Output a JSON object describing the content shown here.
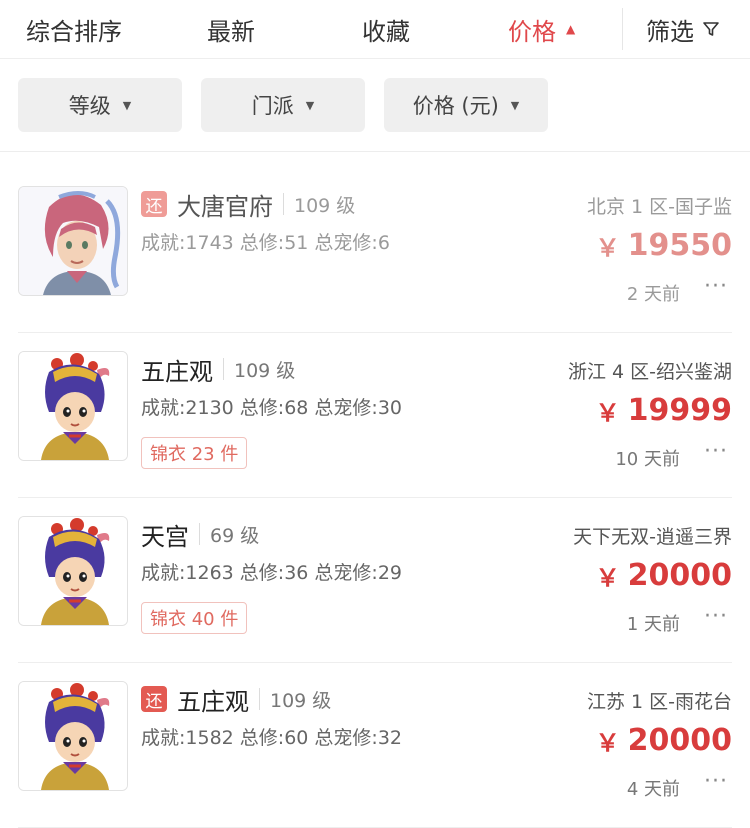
{
  "tabs": [
    {
      "label": "综合排序"
    },
    {
      "label": "最新"
    },
    {
      "label": "收藏"
    },
    {
      "label": "价格",
      "active": true
    },
    {
      "label": "筛选"
    }
  ],
  "filters": [
    {
      "label": "等级"
    },
    {
      "label": "门派"
    },
    {
      "label": "价格 (元)"
    }
  ],
  "items": [
    {
      "badge": "还",
      "sect": "大唐官府",
      "level": "109 级",
      "server": "北京 1 区-国子监",
      "stats": "成就:1743 总修:51 总宠修:6",
      "currency": "￥",
      "price": "19550",
      "time": "2 天前",
      "more": "···"
    },
    {
      "sect": "五庄观",
      "level": "109 级",
      "server": "浙江 4 区-绍兴鉴湖",
      "stats": "成就:2130 总修:68 总宠修:30",
      "tag": "锦衣 23 件",
      "currency": "￥",
      "price": "19999",
      "time": "10 天前",
      "more": "···"
    },
    {
      "sect": "天宫",
      "level": "69 级",
      "server": "天下无双-逍遥三界",
      "stats": "成就:1263 总修:36 总宠修:29",
      "tag": "锦衣 40 件",
      "currency": "￥",
      "price": "20000",
      "time": "1 天前",
      "more": "···"
    },
    {
      "badge": "还",
      "sect": "五庄观",
      "level": "109 级",
      "server": "江苏 1 区-雨花台",
      "stats": "成就:1582 总修:60 总宠修:32",
      "currency": "￥",
      "price": "20000",
      "time": "4 天前",
      "more": "···"
    }
  ],
  "colors": {
    "accent": "#e0484b",
    "price": "#d83c3c",
    "badge": "#e35a52"
  },
  "icons": {
    "sort_arrow": "triangle-up-icon",
    "filter": "funnel-icon",
    "dropdown": "triangle-down-icon",
    "more": "ellipsis-icon"
  }
}
